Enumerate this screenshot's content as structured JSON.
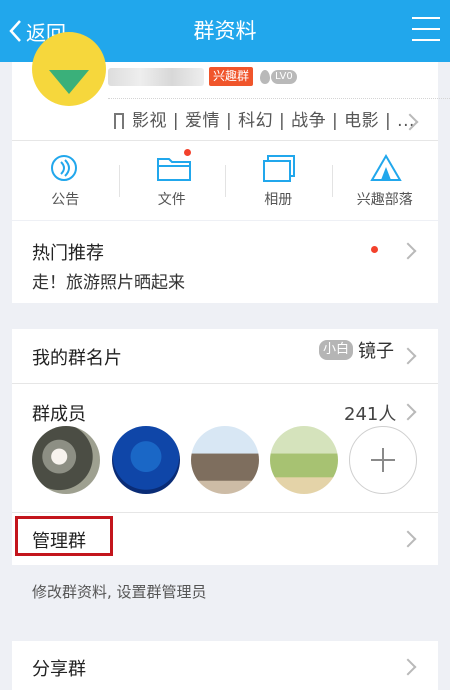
{
  "header": {
    "back_label": "返回",
    "title": "群资料"
  },
  "group": {
    "tag_badge": "兴趣群",
    "level_badge": "LV0",
    "tags": "影视 | 爱情 | 科幻 | 战争 | 电影 | ..."
  },
  "actions": [
    {
      "label": "公告",
      "icon": "announcement-icon"
    },
    {
      "label": "文件",
      "icon": "folder-icon"
    },
    {
      "label": "相册",
      "icon": "album-icon"
    },
    {
      "label": "兴趣部落",
      "icon": "tribe-icon"
    }
  ],
  "hot": {
    "title": "热门推荐",
    "subtitle": "走！旅游照片晒起来"
  },
  "card_row": {
    "title": "我的群名片",
    "badge": "小白",
    "nickname": "镜子"
  },
  "members": {
    "title": "群成员",
    "count": "241人"
  },
  "manage": {
    "title": "管理群",
    "hint": "修改群资料, 设置群管理员"
  },
  "share": {
    "title": "分享群"
  },
  "colors": {
    "accent": "#21a7ec",
    "badge_red": "#f0552b",
    "highlight": "#c3151c"
  }
}
